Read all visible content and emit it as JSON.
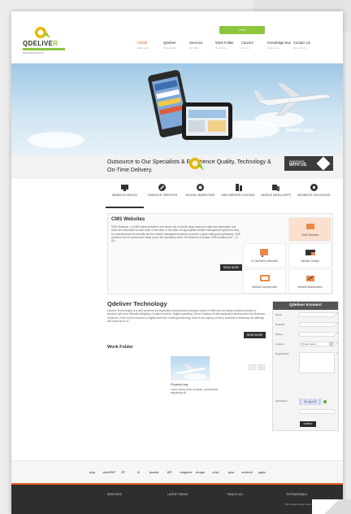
{
  "header": {
    "logo_text_dark": "QDELIVE",
    "logo_text_accent": "R",
    "logo_tagline": "DELIVER QUALITY",
    "login_label": "LOGIN"
  },
  "nav": [
    {
      "title": "HOME",
      "sub": "Welcome to",
      "active": true
    },
    {
      "title": "Qdeliver",
      "sub": "Who are We",
      "active": false
    },
    {
      "title": "Services",
      "sub": "We Offer",
      "active": false
    },
    {
      "title": "Work Folder",
      "sub": "Our Works",
      "active": false
    },
    {
      "title": "Careers",
      "sub": "Join Us",
      "active": false
    },
    {
      "title": "Knowledge Box",
      "sub": "Learn more",
      "active": false
    },
    {
      "title": "Contact Us",
      "sub": "Get in Touch",
      "active": false
    }
  ],
  "banner": {
    "caption": "Mobile Apps",
    "outsource_text": "Outsource to Our Specialists & Experience     Quality, Technology & On-Time Delivery.",
    "partner_line1": "PARTNER",
    "partner_line2": "WITH US"
  },
  "service_tabs": [
    {
      "label": "WEBSITE DESIGN",
      "icon": "monitor-icon",
      "selected": true
    },
    {
      "label": "CREATIVE SERVICES",
      "icon": "pencil-icon",
      "selected": false
    },
    {
      "label": "DIGITAL MARKETING",
      "icon": "target-icon",
      "selected": false
    },
    {
      "label": "WEB SERVER HOSTING",
      "icon": "server-icon",
      "selected": false
    },
    {
      "label": "MOBILE WEB & APPS",
      "icon": "mobile-icon",
      "selected": false
    },
    {
      "label": "BUSINESS SOLUTIONS",
      "icon": "gear-icon",
      "selected": false
    }
  ],
  "cms": {
    "title": "CMS Websites",
    "body": "CMS Solutions – A CMS based website is one which has to handle large amount of data and information and some are connected to each other in one form or the other. An appropriate content management system is easy to understand and its benefits are the content management system provides a quick editing and publishing. CMS solutions can be customized easily as per the customers need. The features of custom CMS solutions are :- 1) Qu...",
    "read_more": "READ MORE",
    "cells": [
      {
        "label": "CMS Websites",
        "icon": "cms-icon",
        "highlight": true
      },
      {
        "label": "E-Commerce Websites",
        "icon": "cart-icon",
        "highlight": false
      },
      {
        "label": "Website Design",
        "icon": "design-icon",
        "highlight": false
      },
      {
        "label": "Website Development",
        "icon": "dev-icon",
        "highlight": false
      },
      {
        "label": "Website Maintenance",
        "icon": "maintenance-icon",
        "highlight": false
      }
    ]
  },
  "technology": {
    "title": "Qdeliver Technology",
    "body": "Qdeliver Technologies is a web solutions and application development company based in Delhi and providing complete portfolio of services right from Website designing, Creative services, Digital marketing, Server Hosting, Mobile application development and Business Solutions. In the current scenario of digital world and evolving technology, there is an urgency of every business to showcase its offerings and brand as of co...",
    "read_more": "READ MORE"
  },
  "work_folder": {
    "title": "Work Folder",
    "project_name": "Project# img",
    "project_desc": "Lorem ipsum dolor sit amet, consectetuer adipiscing elit.",
    "prev": "‹",
    "next": "›"
  },
  "konnect": {
    "title": "Qdeliver Konnect",
    "fields": [
      "Name",
      "Email ID",
      "Phone",
      "Country",
      "Project Brief",
      "Verification"
    ],
    "country_value": "Please Select",
    "captcha_text": "1 U g m T",
    "submit": "SUBMIT"
  },
  "tech_logos": [
    "php",
    "cakePHP",
    "ZF",
    "XI",
    "joomla",
    "WP",
    "magento",
    "drupal",
    "aJax",
    "java",
    "android",
    "apple"
  ],
  "footer": {
    "columns": [
      "SERVICES",
      "LATEST NEWS",
      "REACH US",
      "TESTIMONIALS"
    ],
    "note": "The website being made is same as..."
  },
  "colors": {
    "accent": "#e55a1c",
    "brand_green": "#8cc63f",
    "dark": "#2e2e2e"
  }
}
